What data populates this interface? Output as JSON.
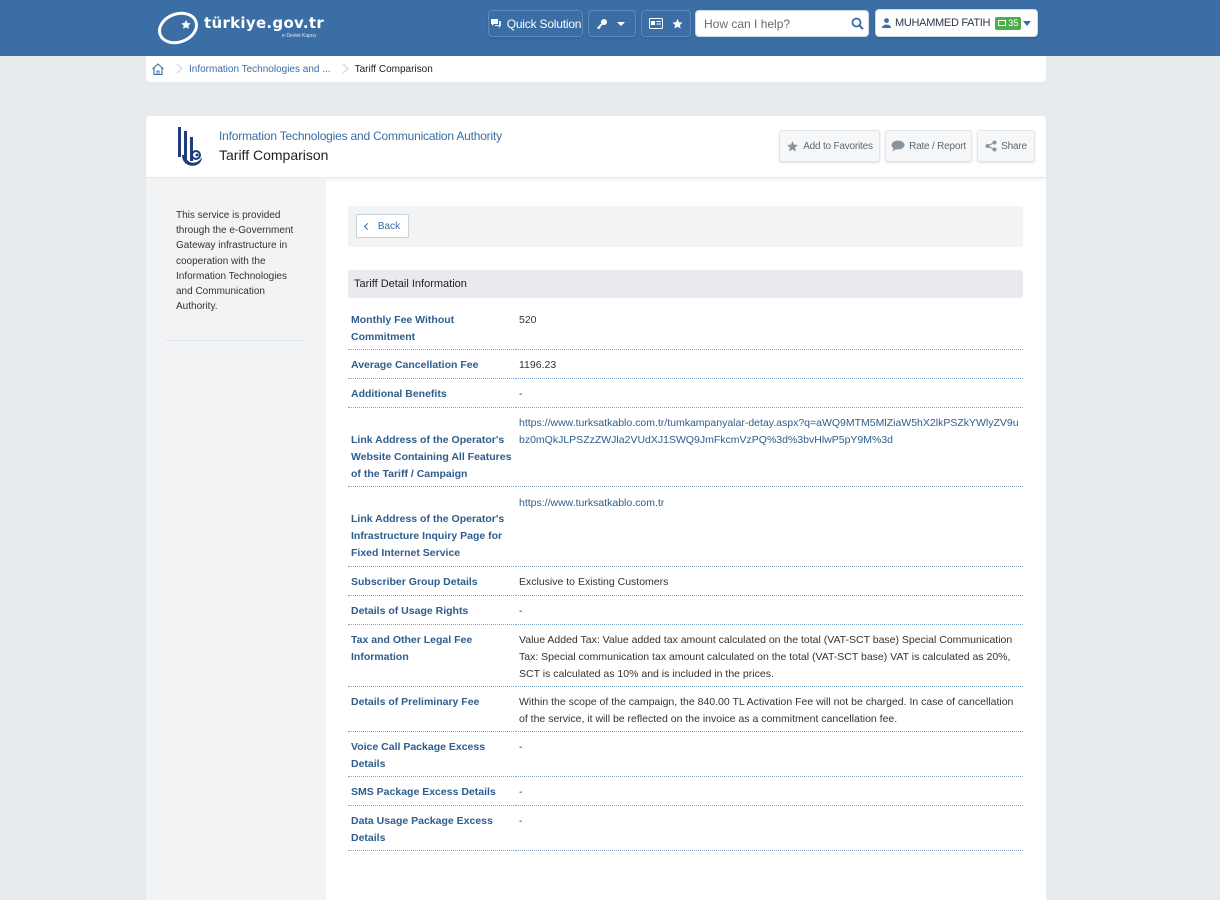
{
  "header": {
    "logo_text": "türkiye.gov.tr",
    "logo_sub": "e-Devlet Kapısı",
    "quick_solution": "Quick Solution",
    "search_placeholder": "How can I help?",
    "user_name": "MUHAMMED FATIH",
    "message_count": "35"
  },
  "breadcrumb": {
    "items": [
      "Information Technologies and ...",
      "Tariff Comparison"
    ]
  },
  "page": {
    "agency": "Information Technologies and Communication Authority",
    "title": "Tariff Comparison",
    "actions": {
      "favorites": "Add to Favorites",
      "rate": "Rate / Report",
      "share": "Share"
    },
    "sidebar_text": "This service is provided through the e-Government Gateway infrastructure in cooperation with the Information Technologies and Communication Authority.",
    "back": "Back",
    "section_title": "Tariff Detail Information"
  },
  "details": [
    {
      "label": "Monthly Fee Without Commitment",
      "value": "520"
    },
    {
      "label": "Average Cancellation Fee",
      "value": "1196.23"
    },
    {
      "label": "Additional Benefits",
      "value": "-"
    },
    {
      "label": "Link Address of the Operator's Website Containing All Features of the Tariff / Campaign",
      "value": "https://www.turksatkablo.com.tr/tumkampanyalar-detay.aspx?q=aWQ9MTM5MlZiaW5hX2lkPSZkYWlyZV9ubz0mQkJLPSZzZWJla2VUdXJ1SWQ9JmFkcmVzPQ%3d%3bvHlwP5pY9M%3d"
    },
    {
      "label": "Link Address of the Operator's Infrastructure Inquiry Page for Fixed Internet Service",
      "value": "https://www.turksatkablo.com.tr"
    },
    {
      "label": "Subscriber Group Details",
      "value": "Exclusive to Existing Customers"
    },
    {
      "label": "Details of Usage Rights",
      "value": "-"
    },
    {
      "label": "Tax and Other Legal Fee Information",
      "value": "Value Added Tax: Value added tax amount calculated on the total (VAT-SCT base) Special Communication Tax: Special communication tax amount calculated on the total (VAT-SCT base) VAT is calculated as 20%, SCT is calculated as 10% and is included in the prices."
    },
    {
      "label": "Details of Preliminary Fee",
      "value": "Within the scope of the campaign, the 840.00 TL Activation Fee will not be charged. In case of cancellation of the service, it will be reflected on the invoice as a commitment cancellation fee."
    },
    {
      "label": "Voice Call Package Excess Details",
      "value": "-"
    },
    {
      "label": "SMS Package Excess Details",
      "value": "-"
    },
    {
      "label": "Data Usage Package Excess Details",
      "value": "-"
    }
  ],
  "colors": {
    "header_blue": "#3a6ea5",
    "label_blue": "#2e5d8e",
    "badge_green": "#4cae4c"
  }
}
